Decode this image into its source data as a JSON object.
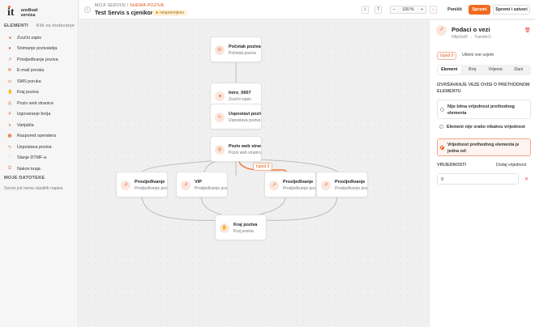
{
  "brand": {
    "logo": "it",
    "line1": "uređivač",
    "line2": "servisa"
  },
  "sidebar": {
    "elements_title": "ELEMENTI",
    "elements_hint": "Klik za dodavanje",
    "items": [
      {
        "label": "Zvučni zapis",
        "icon": "speaker-icon",
        "glyph": "◂"
      },
      {
        "label": "Snimanje pozivatelja",
        "icon": "microphone-icon",
        "glyph": "●"
      },
      {
        "label": "Prosljeđivanje poziva",
        "icon": "forward-icon",
        "glyph": "↗"
      },
      {
        "label": "E-mail poruka",
        "icon": "mail-icon",
        "glyph": "✉"
      },
      {
        "label": "SMS poruka",
        "icon": "sms-icon",
        "glyph": "▭"
      },
      {
        "label": "Kraj poziva",
        "icon": "hangup-icon",
        "glyph": "✋"
      },
      {
        "label": "Poziv web stranice",
        "icon": "globe-icon",
        "glyph": "◎"
      },
      {
        "label": "Izgovaranje broja",
        "icon": "number-icon",
        "glyph": "#"
      },
      {
        "label": "Varijabla",
        "icon": "variable-icon",
        "glyph": "x"
      },
      {
        "label": "Raspored operatera",
        "icon": "schedule-icon",
        "glyph": "▦"
      },
      {
        "label": "Uspostava poziva",
        "icon": "call-setup-icon",
        "glyph": "∿"
      },
      {
        "label": "Slanje DTMF-a",
        "icon": "dtmf-icon",
        "glyph": "⋮"
      },
      {
        "label": "Nakon kraja",
        "icon": "after-end-icon",
        "glyph": "⏻"
      }
    ],
    "files_title": "MOJE DATOTEKE",
    "files_empty": "Servis još nema vlastitih napiva"
  },
  "header": {
    "crumb_root": "MOJI SERVISI",
    "crumb_sep": "/",
    "crumb_current": "SHEMA POZIVA",
    "title": "Test Servis s cjenikom",
    "status": "nespremljeno",
    "zoom": "100 %",
    "zoom_minus": "−",
    "zoom_plus": "+",
    "cancel": "Poništi",
    "save": "Spremi",
    "save_close": "Spremi i zatvori"
  },
  "nodes": [
    {
      "title": "Početak poziva",
      "subtitle": "Početak poziva",
      "icon": "phone-icon",
      "glyph": "☏"
    },
    {
      "title": "Intro_0607",
      "subtitle": "Zvučni zapis",
      "icon": "speaker-icon",
      "glyph": "◂"
    },
    {
      "title": "Uspostavi poziv",
      "subtitle": "Uspostava poziva",
      "icon": "call-setup-icon",
      "glyph": "∿"
    },
    {
      "title": "Poziv web stranice",
      "subtitle": "Poziv web stranice",
      "icon": "globe-icon",
      "glyph": "◎"
    },
    {
      "title": "Prosljeđivanje",
      "subtitle": "Prosljeđivanje poziva",
      "icon": "forward-icon",
      "glyph": "↗"
    },
    {
      "title": "VIP",
      "subtitle": "Prosljeđivanje poziva",
      "icon": "forward-icon",
      "glyph": "↗"
    },
    {
      "title": "Prosljeđivanje",
      "subtitle": "Prosljeđivanje poziva",
      "icon": "forward-icon",
      "glyph": "↗"
    },
    {
      "title": "Prosljeđivanje",
      "subtitle": "Prosljeđivanje poziva",
      "icon": "forward-icon",
      "glyph": "↗"
    },
    {
      "title": "Kraj poziva",
      "subtitle": "Kraj poziva",
      "icon": "hangup-icon",
      "glyph": "✋"
    }
  ],
  "edge_label": "Ispod 0",
  "panel": {
    "title": "Podaci o vezi",
    "subtitle": "HttpGet0 → Transfer1",
    "tag": "Ispod 0",
    "remove_all": "Ukloni sve uvjete",
    "tabs": [
      "Element",
      "Broj",
      "Vrijeme",
      "Dani"
    ],
    "question": "IZVRŠAVANJE VEZE OVISI O PRETHODNOM ELEMENTU",
    "options": [
      "Nije bitna vrijednost prethodnog elementa",
      "Element nije vratio nikakvu vrijednost",
      "Vrijednost prethodnog elementa je jedna od:"
    ],
    "values_title": "VRIJEDNOSTI",
    "add_value": "Dodaj vrijednost",
    "value": "0"
  },
  "colors": {
    "accent": "#e2571a"
  }
}
